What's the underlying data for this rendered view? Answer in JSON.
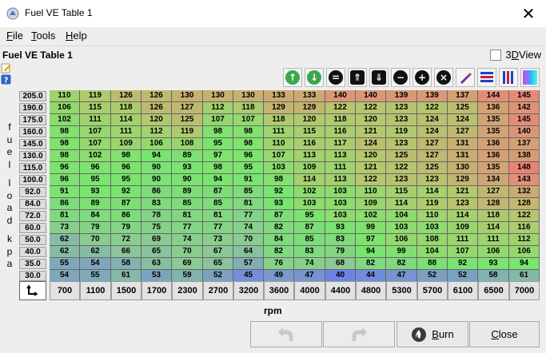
{
  "window": {
    "title": "Fuel VE Table 1",
    "close_glyph": "✕"
  },
  "menu": [
    {
      "label": "File",
      "mnemonic": "F",
      "rest": "ile"
    },
    {
      "label": "Tools",
      "mnemonic": "T",
      "rest": "ools"
    },
    {
      "label": "Help",
      "mnemonic": "H",
      "rest": "elp"
    }
  ],
  "table_title": "Fuel VE Table 1",
  "view3d": {
    "mnemonic": "D",
    "prefix": "3",
    "rest": " View",
    "label": "3D View",
    "checked": false
  },
  "toolbar_icons": [
    "increment-green-icon",
    "decrement-green-icon",
    "set-equal-icon",
    "shift-up-icon",
    "shift-down-icon",
    "minus-icon",
    "plus-icon",
    "scale-icon",
    "smooth-pen-icon",
    "horizontal-interpolate-icon",
    "vertical-interpolate-icon",
    "gradient-color-icon"
  ],
  "y_axis_label": "fuel load kpa",
  "y_axis_label_chars": [
    "f",
    "u",
    "e",
    "l",
    "",
    "l",
    "o",
    "a",
    "d",
    "",
    "k",
    "p",
    "a"
  ],
  "x_axis_label": "rpm",
  "row_headers": [
    "205.0",
    "190.0",
    "175.0",
    "160.0",
    "145.0",
    "130.0",
    "115.0",
    "100.0",
    "92.0",
    "84.0",
    "72.0",
    "60.0",
    "50.0",
    "40.0",
    "35.0",
    "30.0"
  ],
  "col_headers": [
    "700",
    "1100",
    "1500",
    "1700",
    "2300",
    "2700",
    "3200",
    "3600",
    "4000",
    "4400",
    "4800",
    "5300",
    "5700",
    "6100",
    "6500",
    "7000"
  ],
  "cells": [
    [
      110,
      119,
      126,
      126,
      130,
      130,
      130,
      133,
      133,
      140,
      140,
      139,
      139,
      137,
      144,
      145
    ],
    [
      106,
      115,
      118,
      126,
      127,
      112,
      118,
      129,
      129,
      122,
      122,
      123,
      122,
      125,
      136,
      142
    ],
    [
      102,
      111,
      114,
      120,
      125,
      107,
      107,
      118,
      120,
      118,
      120,
      123,
      124,
      124,
      135,
      145
    ],
    [
      98,
      107,
      111,
      112,
      119,
      98,
      98,
      111,
      115,
      116,
      121,
      119,
      124,
      127,
      135,
      140
    ],
    [
      98,
      107,
      109,
      106,
      108,
      95,
      98,
      110,
      116,
      117,
      124,
      123,
      127,
      131,
      136,
      137
    ],
    [
      98,
      102,
      98,
      94,
      89,
      97,
      96,
      107,
      113,
      113,
      120,
      125,
      127,
      131,
      136,
      138
    ],
    [
      96,
      96,
      96,
      90,
      93,
      98,
      95,
      103,
      109,
      111,
      121,
      122,
      125,
      130,
      135,
      148
    ],
    [
      96,
      95,
      95,
      90,
      90,
      94,
      91,
      98,
      114,
      113,
      122,
      123,
      123,
      129,
      134,
      143
    ],
    [
      91,
      93,
      92,
      86,
      89,
      87,
      85,
      92,
      102,
      103,
      110,
      115,
      114,
      121,
      127,
      132
    ],
    [
      86,
      89,
      87,
      83,
      85,
      85,
      81,
      93,
      103,
      103,
      109,
      114,
      119,
      123,
      128,
      128
    ],
    [
      81,
      84,
      86,
      78,
      81,
      81,
      77,
      87,
      95,
      103,
      102,
      104,
      110,
      114,
      118,
      122
    ],
    [
      73,
      79,
      79,
      75,
      77,
      77,
      74,
      82,
      87,
      93,
      99,
      103,
      103,
      109,
      114,
      116
    ],
    [
      62,
      70,
      72,
      69,
      74,
      73,
      70,
      84,
      85,
      83,
      97,
      106,
      108,
      111,
      111,
      112
    ],
    [
      62,
      62,
      66,
      65,
      70,
      67,
      64,
      82,
      83,
      79,
      94,
      99,
      104,
      107,
      106,
      106
    ],
    [
      55,
      54,
      58,
      63,
      69,
      65,
      57,
      76,
      74,
      68,
      82,
      82,
      88,
      92,
      93,
      94
    ],
    [
      54,
      55,
      61,
      53,
      59,
      52,
      45,
      49,
      47,
      40,
      44,
      47,
      52,
      52,
      58,
      61
    ]
  ],
  "buttons": {
    "undo_icon": "undo-arrow-icon",
    "redo_icon": "redo-arrow-icon",
    "burn": {
      "mnemonic": "B",
      "rest": "urn",
      "label": "Burn"
    },
    "close": {
      "mnemonic": "C",
      "rest": "lose",
      "label": "Close"
    }
  }
}
